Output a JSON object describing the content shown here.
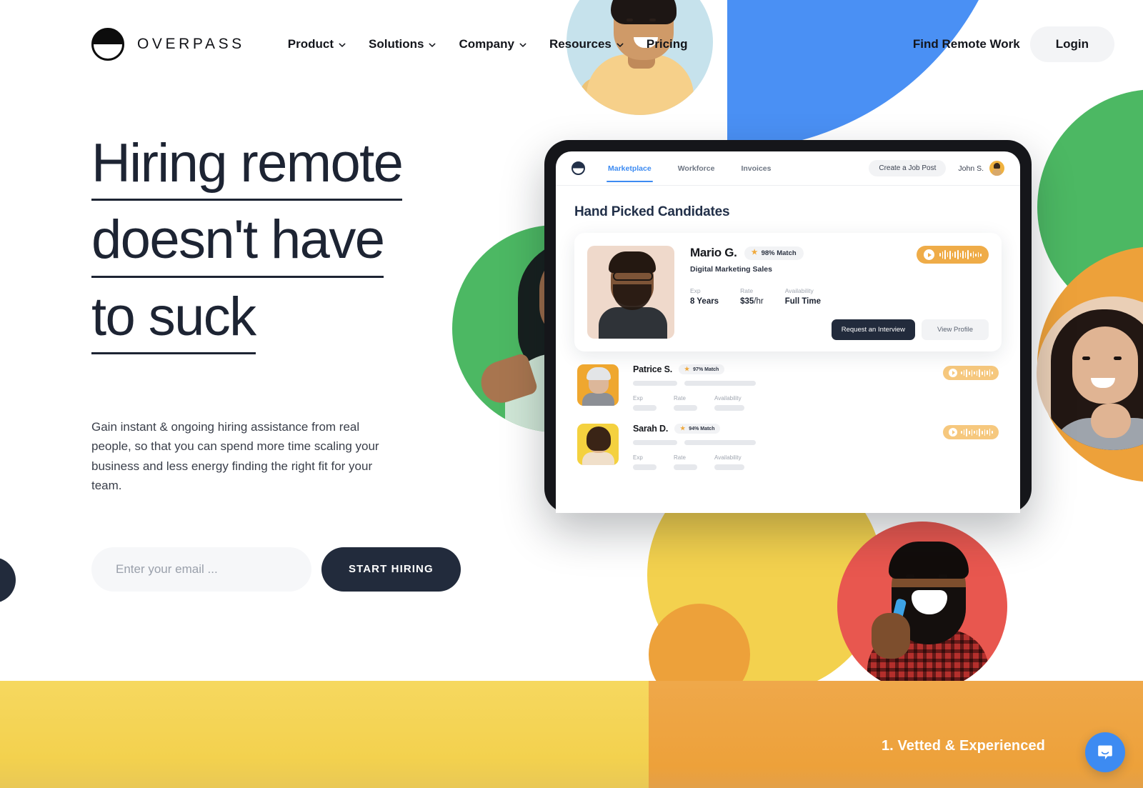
{
  "brand": {
    "name": "OVERPASS",
    "logo_icon": "overpass-circle-logo"
  },
  "nav": {
    "links": [
      {
        "label": "Product",
        "has_dropdown": true
      },
      {
        "label": "Solutions",
        "has_dropdown": true
      },
      {
        "label": "Company",
        "has_dropdown": true
      },
      {
        "label": "Resources",
        "has_dropdown": true
      },
      {
        "label": "Pricing",
        "has_dropdown": false
      }
    ],
    "find_work": "Find Remote Work",
    "login": "Login"
  },
  "hero": {
    "headline_lines": [
      "Hiring remote",
      "doesn't have",
      "to suck"
    ],
    "subtext": "Gain instant & ongoing hiring assistance from real people, so that you can spend more time scaling your business and less energy finding the right fit for your team.",
    "email_placeholder": "Enter your email ...",
    "email_value": "",
    "cta_label": "START HIRING"
  },
  "app": {
    "tabs": [
      {
        "label": "Marketplace",
        "active": true
      },
      {
        "label": "Workforce",
        "active": false
      },
      {
        "label": "Invoices",
        "active": false
      }
    ],
    "create_job_post": "Create a Job Post",
    "user_name": "John S.",
    "section_title": "Hand Picked Candidates",
    "featured": {
      "name": "Mario G.",
      "match": "98% Match",
      "role": "Digital Marketing Sales",
      "stats": [
        {
          "label": "Exp",
          "value": "8 Years"
        },
        {
          "label": "Rate",
          "value": "$35",
          "unit": "/hr"
        },
        {
          "label": "Availability",
          "value": "Full Time"
        }
      ],
      "primary_action": "Request an Interview",
      "secondary_action": "View Profile"
    },
    "stat_labels": {
      "exp": "Exp",
      "rate": "Rate",
      "availability": "Availability"
    },
    "rows": [
      {
        "name": "Patrice S.",
        "match": "97% Match"
      },
      {
        "name": "Sarah D.",
        "match": "94% Match"
      }
    ]
  },
  "banner": {
    "caption": "1. Vetted & Experienced"
  },
  "widget": {
    "icon": "intercom-chat-icon"
  },
  "colors": {
    "accent_blue": "#3d8bf2",
    "brand_dark": "#222b3c",
    "green": "#4cb863",
    "yellow": "#f3d14e",
    "orange": "#eda13a",
    "red": "#e8574f",
    "light_blue": "#c6e2ec"
  }
}
